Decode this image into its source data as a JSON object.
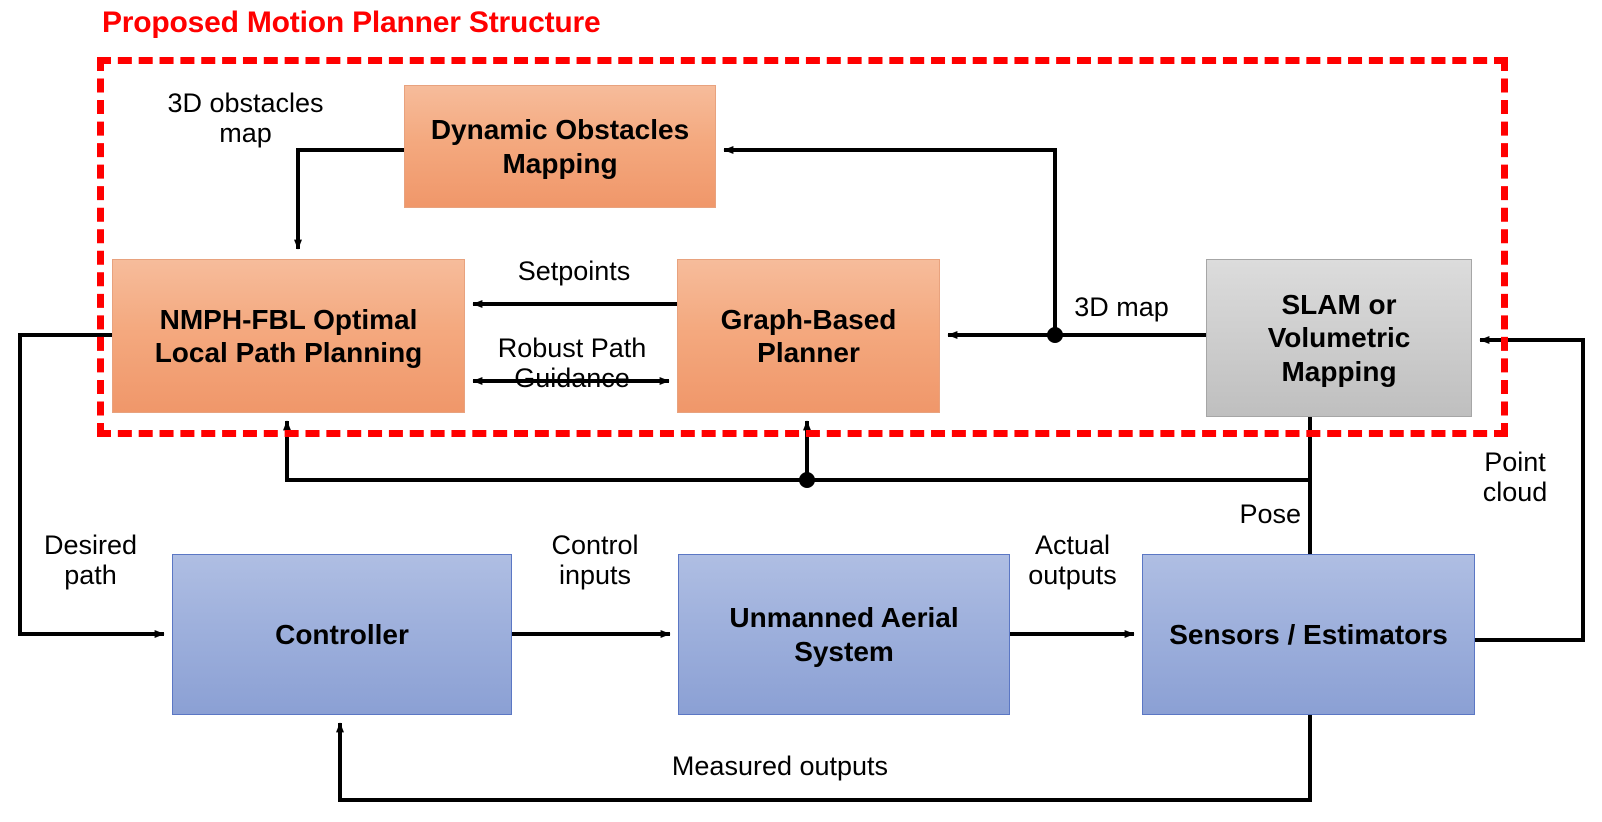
{
  "diagram": {
    "title": "Proposed Motion Planner Structure",
    "title_color": "#FF0000",
    "boundary_color": "#FF0000",
    "colors": {
      "planner_block": "#F4A97F",
      "mapping_block": "#CFCFCF",
      "platform_block": "#9EB0DC",
      "connector": "#000000"
    },
    "nodes": [
      {
        "id": "dynamic-obstacles-mapping",
        "label": "Dynamic Obstacles Mapping",
        "group": "planner"
      },
      {
        "id": "nmph-fbl-optimal-local-path-planning",
        "label": "NMPH-FBL Optimal Local Path Planning",
        "group": "planner"
      },
      {
        "id": "graph-based-planner",
        "label": "Graph-Based Planner",
        "group": "planner"
      },
      {
        "id": "slam-or-volumetric-mapping",
        "label": "SLAM  or Volumetric Mapping",
        "group": "mapping"
      },
      {
        "id": "controller",
        "label": "Controller",
        "group": "platform"
      },
      {
        "id": "unmanned-aerial-system",
        "label": "Unmanned Aerial System",
        "group": "platform"
      },
      {
        "id": "sensors-estimators",
        "label": "Sensors / Estimators",
        "group": "platform"
      }
    ],
    "edge_labels": [
      {
        "id": "three-d-obstacles-map",
        "text_line1": "3D obstacles",
        "text_line2": "map"
      },
      {
        "id": "setpoints",
        "text": "Setpoints"
      },
      {
        "id": "robust-path-guidance",
        "text_line1": "Robust Path",
        "text_line2": "Guidance"
      },
      {
        "id": "three-d-map",
        "text": "3D map"
      },
      {
        "id": "desired-path",
        "text_line1": "Desired",
        "text_line2": "path"
      },
      {
        "id": "control-inputs",
        "text_line1": "Control",
        "text_line2": "inputs"
      },
      {
        "id": "actual-outputs",
        "text_line1": "Actual",
        "text_line2": "outputs"
      },
      {
        "id": "pose",
        "text": "Pose"
      },
      {
        "id": "point-cloud",
        "text_line1": "Point",
        "text_line2": "cloud"
      },
      {
        "id": "measured-outputs",
        "text": "Measured outputs"
      }
    ]
  }
}
